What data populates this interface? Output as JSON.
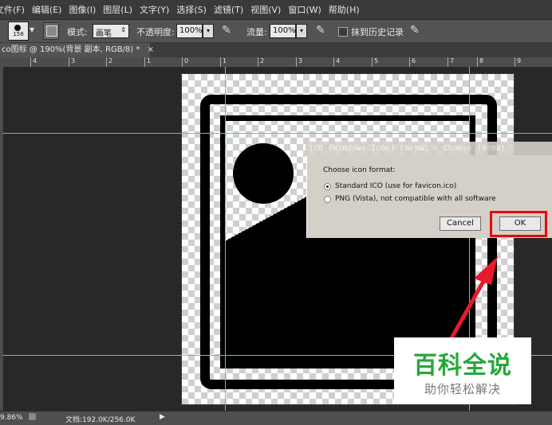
{
  "menubar": {
    "items": [
      "文件(F)",
      "编辑(E)",
      "图像(I)",
      "图层(L)",
      "文字(Y)",
      "选择(S)",
      "滤镜(T)",
      "视图(V)",
      "窗口(W)",
      "帮助(H)"
    ]
  },
  "options": {
    "brush_size": "158",
    "mode_label": "模式:",
    "mode_value": "画笔",
    "opacity_label": "不透明度:",
    "opacity_value": "100%",
    "flow_label": "流量:",
    "flow_value": "100%",
    "erase_history_label": "抹到历史记录"
  },
  "document": {
    "tab_title": "co图标 @ 190%(背景 副本, RGB/8) *",
    "close_glyph": "×"
  },
  "ruler": {
    "labels": [
      "4",
      "3",
      "2",
      "1",
      "0",
      "1",
      "2",
      "3",
      "4",
      "5",
      "6",
      "7",
      "8",
      "9"
    ]
  },
  "dialog": {
    "title": "ICO (Windows Icon) Format - Choose format",
    "prompt": "Choose icon format:",
    "options": [
      "Standard ICO (use for favicon.ico)",
      "PNG (Vista), not compatible with all software"
    ],
    "selected_index": 0,
    "cancel_label": "Cancel",
    "ok_label": "OK"
  },
  "watermark": {
    "title": "百科全说",
    "subtitle": "助你轻松解决"
  },
  "status": {
    "zoom": "9.86%",
    "doc_info": "文档:192.0K/256.0K"
  },
  "colors": {
    "guide": "#4cc9cc",
    "highlight": "#e00000",
    "arrow": "#e8192c",
    "watermark_green": "#27a83a"
  }
}
